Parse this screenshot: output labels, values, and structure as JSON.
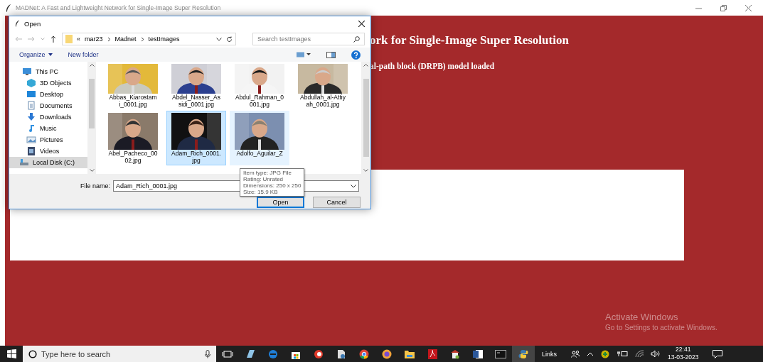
{
  "window": {
    "title": "MADNet: A Fast and Lightweight Network for Single-Image Super Resolution"
  },
  "app": {
    "heading": "ork for Single-Image Super Resolution",
    "status": "al-path block (DRPB) model loaded"
  },
  "dialog": {
    "title": "Open",
    "breadcrumb": {
      "prefix": "«",
      "parts": [
        "mar23",
        "Madnet",
        "testImages"
      ]
    },
    "search": {
      "placeholder": "Search testImages"
    },
    "toolbar": [
      "Organize",
      "New folder"
    ],
    "nav": [
      {
        "label": "This PC",
        "kind": "pc",
        "selected": false
      },
      {
        "label": "3D Objects",
        "kind": "objects",
        "selected": false
      },
      {
        "label": "Desktop",
        "kind": "desktop",
        "selected": false
      },
      {
        "label": "Documents",
        "kind": "documents",
        "selected": false
      },
      {
        "label": "Downloads",
        "kind": "downloads",
        "selected": false
      },
      {
        "label": "Music",
        "kind": "music",
        "selected": false
      },
      {
        "label": "Pictures",
        "kind": "pictures",
        "selected": false
      },
      {
        "label": "Videos",
        "kind": "videos",
        "selected": false
      },
      {
        "label": "Local Disk (C:)",
        "kind": "disk",
        "selected": true
      }
    ],
    "files": [
      {
        "name": "Abbas_Kiarostam\ni_0001.jpg",
        "selected": false,
        "hovered": false
      },
      {
        "name": "Abdel_Nasser_As\nsidi_0001.jpg",
        "selected": false,
        "hovered": false
      },
      {
        "name": "Abdul_Rahman_0\n001.jpg",
        "selected": false,
        "hovered": false
      },
      {
        "name": "Abdullah_al-Attiy\nah_0001.jpg",
        "selected": false,
        "hovered": false
      },
      {
        "name": "Abel_Pacheco_00\n02.jpg",
        "selected": false,
        "hovered": false
      },
      {
        "name": "Adam_Rich_0001.\njpg",
        "selected": true,
        "hovered": false
      },
      {
        "name": "Adolfo_Aguilar_Z",
        "selected": false,
        "hovered": true
      }
    ],
    "tooltip": [
      "Item type: JPG File",
      "Rating: Unrated",
      "Dimensions: 250 x 250",
      "Size: 15.9 KB"
    ],
    "filename": {
      "label": "File name:",
      "value": "Adam_Rich_0001.jpg"
    },
    "buttons": [
      {
        "label": "Open",
        "default": true
      },
      {
        "label": "Cancel",
        "default": false
      }
    ]
  },
  "watermark": {
    "title": "Activate Windows",
    "subtitle": "Go to Settings to activate Windows."
  },
  "taskbar": {
    "search": {
      "placeholder": "Type here to search"
    },
    "links": "Links",
    "time": "22:41",
    "date": "13-03-2023"
  }
}
